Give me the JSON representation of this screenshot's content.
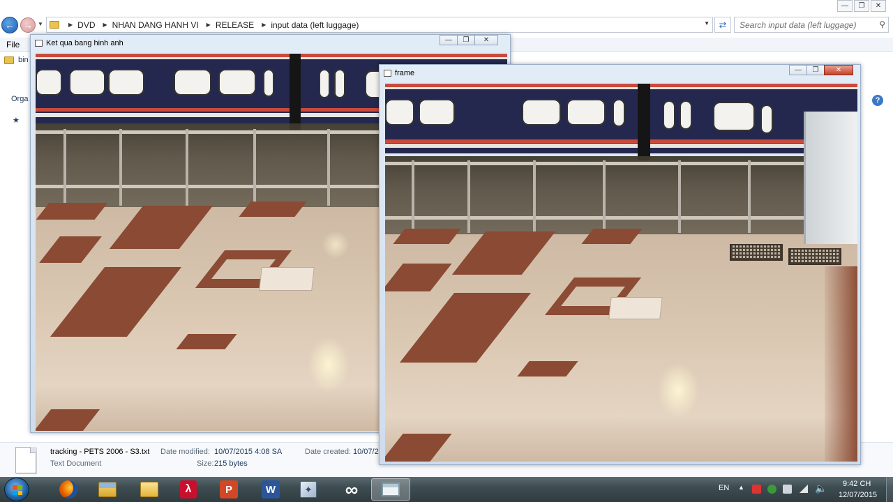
{
  "explorer": {
    "breadcrumbs": [
      "DVD",
      "NHAN DANG HANH VI",
      "RELEASE",
      "input data (left luggage)"
    ],
    "search_placeholder": "Search input data (left luggage)",
    "menu_file": "File",
    "sidebar_peek": [
      "bin",
      "Orga"
    ],
    "status": {
      "file_name": "tracking - PETS 2006 - S3.txt",
      "file_type": "Text Document",
      "date_modified_label": "Date modified:",
      "date_modified": "10/07/2015 4:08 SA",
      "size_label": "Size:",
      "size": "215 bytes",
      "date_created_label": "Date created:",
      "date_created": "10/07/2"
    }
  },
  "window_result": {
    "title": "Ket qua bang hinh anh"
  },
  "window_frame": {
    "title": "frame"
  },
  "taskbar": {
    "apps": [
      "firefox-icon",
      "explorer-icon",
      "folder-icon",
      "acrobat-icon",
      "powerpoint-icon",
      "word-icon",
      "python-icon",
      "visual-studio-icon",
      "opencv-window-icon"
    ],
    "language": "EN",
    "time": "9:42 CH",
    "date": "12/07/2015"
  }
}
